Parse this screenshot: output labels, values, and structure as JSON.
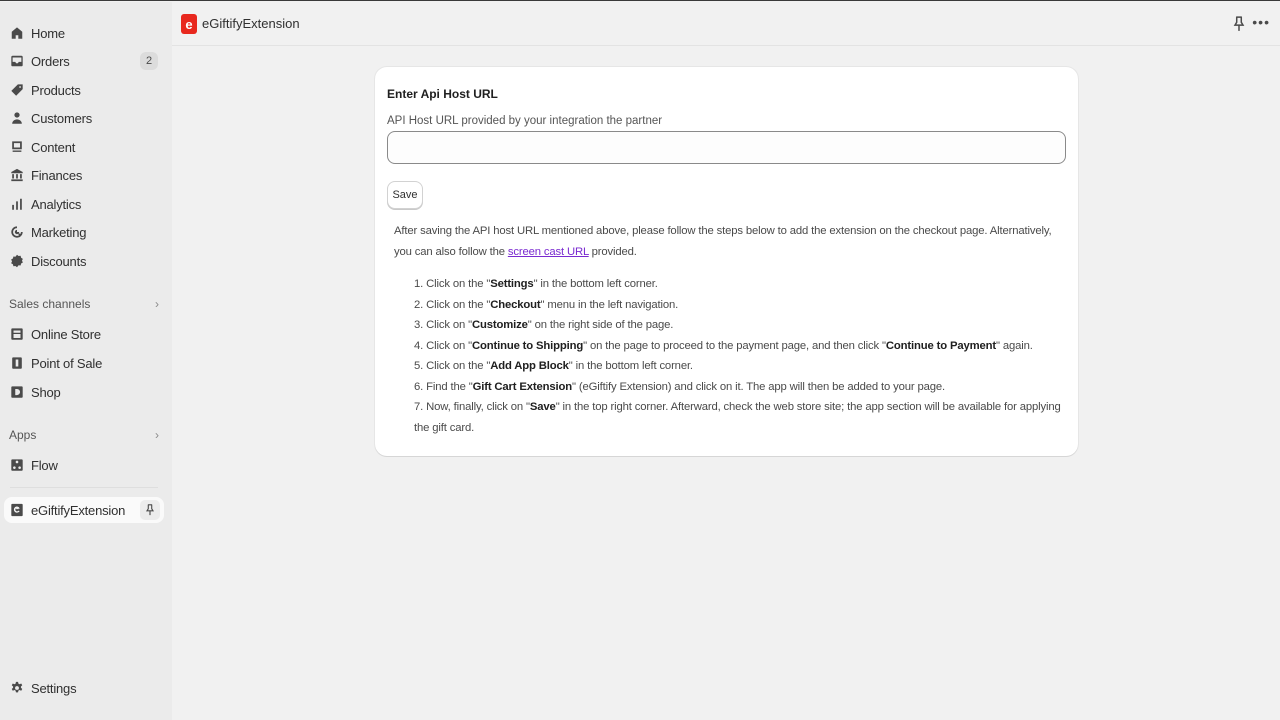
{
  "sidebar": {
    "items": [
      {
        "label": "Home",
        "icon": "home-icon"
      },
      {
        "label": "Orders",
        "icon": "orders-icon",
        "badge": "2"
      },
      {
        "label": "Products",
        "icon": "tag-icon"
      },
      {
        "label": "Customers",
        "icon": "person-icon"
      },
      {
        "label": "Content",
        "icon": "content-icon"
      },
      {
        "label": "Finances",
        "icon": "bank-icon"
      },
      {
        "label": "Analytics",
        "icon": "bar-chart-icon"
      },
      {
        "label": "Marketing",
        "icon": "target-icon"
      },
      {
        "label": "Discounts",
        "icon": "discount-icon"
      }
    ],
    "sales_channels": {
      "heading": "Sales channels",
      "items": [
        {
          "label": "Online Store",
          "icon": "store-icon"
        },
        {
          "label": "Point of Sale",
          "icon": "pos-icon"
        },
        {
          "label": "Shop",
          "icon": "shop-icon"
        }
      ]
    },
    "apps": {
      "heading": "Apps",
      "items": [
        {
          "label": "Flow",
          "icon": "flow-icon"
        }
      ]
    },
    "pinned_app": {
      "label": "eGiftifyExtension",
      "icon": "egiftify-icon"
    },
    "settings": {
      "label": "Settings",
      "icon": "gear-icon"
    }
  },
  "topbar": {
    "app_title": "eGiftifyExtension",
    "logo_letter": "e",
    "more_label": "•••"
  },
  "card": {
    "title": "Enter Api Host URL",
    "field_label": "API Host URL provided by your integration the partner",
    "input_value": "",
    "input_placeholder": "",
    "save_label": "Save",
    "intro_before_link": "After saving the API host URL mentioned above, please follow the steps below to add the extension on the checkout page. Alternatively, you can also follow the ",
    "intro_link": "screen cast URL",
    "intro_after_link": " provided.",
    "steps": [
      {
        "pre": "1. Click on the \"",
        "bold": "Settings",
        "post": "\" in the bottom left corner."
      },
      {
        "pre": "2. Click on the \"",
        "bold": "Checkout",
        "post": "\" menu in the left navigation."
      },
      {
        "pre": "3. Click on \"",
        "bold": "Customize",
        "post": "\" on the right side of the page."
      },
      {
        "pre": "4. Click on \"",
        "bold": "Continue to Shipping",
        "mid": "\" on the page to proceed to the payment page, and then click \"",
        "bold2": "Continue to Payment",
        "post": "\" again."
      },
      {
        "pre": "5. Click on the \"",
        "bold": "Add App Block",
        "post": "\" in the bottom left corner."
      },
      {
        "pre": "6. Find the \"",
        "bold": "Gift Cart Extension",
        "post": "\" (eGiftify Extension) and click on it. The app will then be added to your page."
      },
      {
        "pre": "7. Now, finally, click on \"",
        "bold": "Save",
        "post": "\" in the top right corner. Afterward, check the web store site; the app section will be available for applying the gift card."
      }
    ]
  }
}
